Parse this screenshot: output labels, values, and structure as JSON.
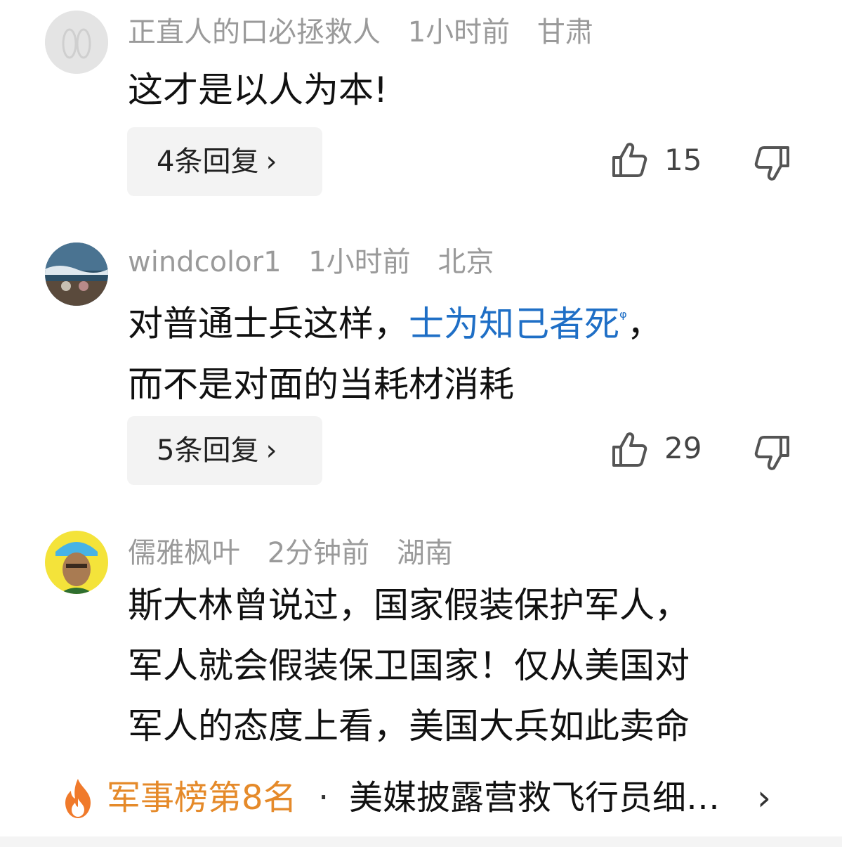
{
  "comments": [
    {
      "username": "正直人的口必拯救人",
      "time": "1小时前",
      "location": "甘肃",
      "text_lines": [
        "这才是以人为本!"
      ],
      "reply_label": "4条回复",
      "likes": "15"
    },
    {
      "username": "windcolor1",
      "time": "1小时前",
      "location": "北京",
      "text_pre": "对普通士兵这样，",
      "text_link": "士为知己者死",
      "text_post": "，",
      "text_line2": "而不是对面的当耗材消耗",
      "reply_label": "5条回复",
      "likes": "29"
    },
    {
      "username": "儒雅枫叶",
      "time": "2分钟前",
      "location": "湖南",
      "text_lines": [
        "斯大林曾说过，国家假装保护军人，",
        "军人就会假装保卫国家！仅从美国对",
        "军人的态度上看，美国大兵如此卖命"
      ]
    }
  ],
  "rank_bar": {
    "label": "军事榜第8名",
    "separator": "·",
    "headline": "美媒披露营救飞行员细…",
    "arrow": "›",
    "accent_color": "#e58a2a"
  },
  "icons": {
    "like": "thumbs-up-icon",
    "dislike": "thumbs-down-icon",
    "search_hint": "search-icon",
    "fire": "fire-icon",
    "chevron": "chevron-right-icon"
  }
}
